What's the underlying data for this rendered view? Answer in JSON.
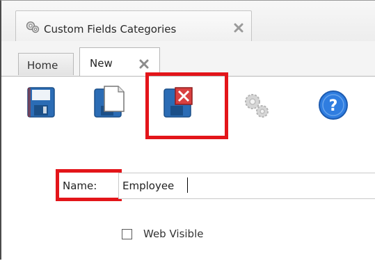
{
  "document_tab": {
    "title": "Custom Fields Categories",
    "icon": "gears-icon"
  },
  "inner_tabs": [
    {
      "label": "Home",
      "active": false
    },
    {
      "label": "New",
      "active": true
    }
  ],
  "toolbar": {
    "buttons": [
      {
        "name": "save-button",
        "icon": "floppy-disk-icon",
        "enabled": true
      },
      {
        "name": "save-new-button",
        "icon": "floppy-document-icon",
        "enabled": true
      },
      {
        "name": "save-close-button",
        "icon": "floppy-red-x-icon",
        "enabled": true,
        "highlighted": true
      },
      {
        "name": "settings-button",
        "icon": "gears-icon",
        "enabled": false
      },
      {
        "name": "help-button",
        "icon": "help-icon",
        "enabled": true
      }
    ]
  },
  "form": {
    "name_label": "Name:",
    "name_value": "Employee",
    "web_visible_label": "Web Visible",
    "web_visible_checked": false
  },
  "colors": {
    "highlight": "#e3151a",
    "floppy_blue": "#2b6cb5",
    "help_blue": "#2f7de0"
  }
}
